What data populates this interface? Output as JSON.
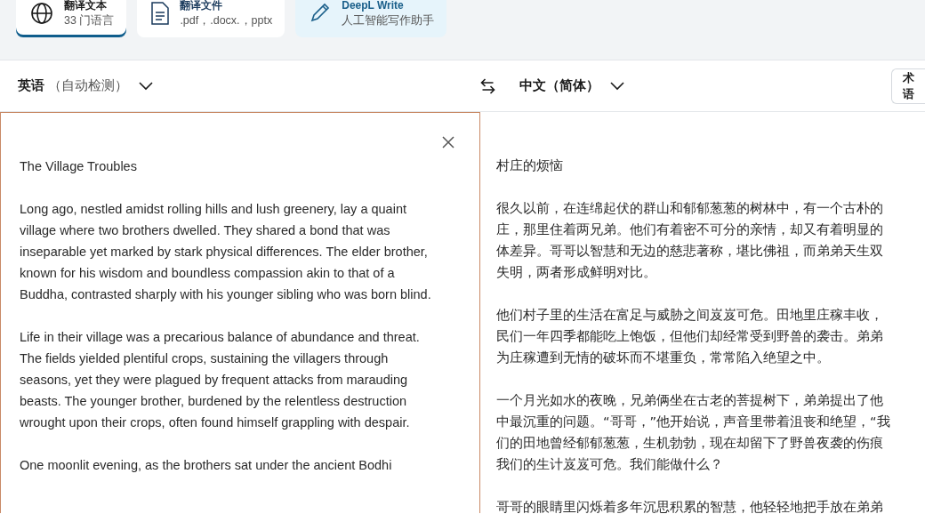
{
  "tabs": [
    {
      "kind": "text",
      "title": "翻译文本",
      "subtitle": "33 门语言",
      "selected": true
    },
    {
      "kind": "document",
      "title": "翻译文件",
      "subtitle": ".pdf，.docx.，pptx",
      "selected": false
    },
    {
      "kind": "write",
      "title": "DeepL Write",
      "subtitle": "人工智能写作助手",
      "selected": false
    }
  ],
  "source_language": {
    "name": "英语",
    "note": "（自动检测）"
  },
  "target_language": {
    "name": "中文（简体）"
  },
  "glossary_button": "术语",
  "source_text": {
    "paragraphs": [
      "The Village Troubles",
      "Long ago, nestled amidst rolling hills and lush greenery, lay a quaint village where two brothers dwelled. They shared a bond that was inseparable yet marked by stark physical differences. The elder brother, known for his wisdom and boundless compassion akin to that of a Buddha, contrasted sharply with his younger sibling who was born blind.",
      "Life in their village was a precarious balance of abundance and threat. The fields yielded plentiful crops, sustaining the villagers through seasons, yet they were plagued by frequent attacks from marauding beasts. The younger brother, burdened by the relentless destruction wrought upon their crops, often found himself grappling with despair.",
      "One moonlit evening, as the brothers sat under the ancient Bodhi"
    ]
  },
  "translation": {
    "paragraphs": [
      [
        "村庄的烦恼"
      ],
      [
        "很久以前，在连绵起伏的群山和郁郁葱葱的树林中，有一个古朴的",
        "庄，那里住着两兄弟。他们有着密不可分的亲情，却又有着明显的",
        "体差异。哥哥以智慧和无边的慈悲著称，堪比佛祖，而弟弟天生双",
        "失明，两者形成鲜明对比。"
      ],
      [
        "他们村子里的生活在富足与威胁之间岌岌可危。田地里庄稼丰收，",
        "民们一年四季都能吃上饱饭，但他们却经常受到野兽的袭击。弟弟",
        "为庄稼遭到无情的破坏而不堪重负，常常陷入绝望之中。"
      ],
      [
        "一个月光如水的夜晚，兄弟俩坐在古老的菩提树下，弟弟提出了他",
        "中最沉重的问题。“哥哥，”他开始说，声音里带着沮丧和绝望，“我",
        "们的田地曾经郁郁葱葱，生机勃勃，现在却留下了野兽夜袭的伤痕",
        "我们的生计岌岌可危。我们能做什么？"
      ],
      [
        "哥哥的眼睛里闪烁着多年沉思积累的智慧，他轻轻地把手放在弟弟"
      ]
    ]
  }
}
